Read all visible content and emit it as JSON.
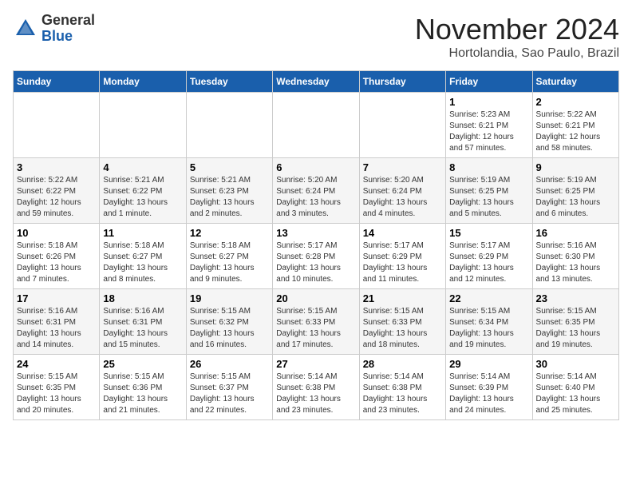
{
  "header": {
    "logo_general": "General",
    "logo_blue": "Blue",
    "month_title": "November 2024",
    "location": "Hortolandia, Sao Paulo, Brazil"
  },
  "weekdays": [
    "Sunday",
    "Monday",
    "Tuesday",
    "Wednesday",
    "Thursday",
    "Friday",
    "Saturday"
  ],
  "weeks": [
    [
      {
        "day": "",
        "info": ""
      },
      {
        "day": "",
        "info": ""
      },
      {
        "day": "",
        "info": ""
      },
      {
        "day": "",
        "info": ""
      },
      {
        "day": "",
        "info": ""
      },
      {
        "day": "1",
        "info": "Sunrise: 5:23 AM\nSunset: 6:21 PM\nDaylight: 12 hours and 57 minutes."
      },
      {
        "day": "2",
        "info": "Sunrise: 5:22 AM\nSunset: 6:21 PM\nDaylight: 12 hours and 58 minutes."
      }
    ],
    [
      {
        "day": "3",
        "info": "Sunrise: 5:22 AM\nSunset: 6:22 PM\nDaylight: 12 hours and 59 minutes."
      },
      {
        "day": "4",
        "info": "Sunrise: 5:21 AM\nSunset: 6:22 PM\nDaylight: 13 hours and 1 minute."
      },
      {
        "day": "5",
        "info": "Sunrise: 5:21 AM\nSunset: 6:23 PM\nDaylight: 13 hours and 2 minutes."
      },
      {
        "day": "6",
        "info": "Sunrise: 5:20 AM\nSunset: 6:24 PM\nDaylight: 13 hours and 3 minutes."
      },
      {
        "day": "7",
        "info": "Sunrise: 5:20 AM\nSunset: 6:24 PM\nDaylight: 13 hours and 4 minutes."
      },
      {
        "day": "8",
        "info": "Sunrise: 5:19 AM\nSunset: 6:25 PM\nDaylight: 13 hours and 5 minutes."
      },
      {
        "day": "9",
        "info": "Sunrise: 5:19 AM\nSunset: 6:25 PM\nDaylight: 13 hours and 6 minutes."
      }
    ],
    [
      {
        "day": "10",
        "info": "Sunrise: 5:18 AM\nSunset: 6:26 PM\nDaylight: 13 hours and 7 minutes."
      },
      {
        "day": "11",
        "info": "Sunrise: 5:18 AM\nSunset: 6:27 PM\nDaylight: 13 hours and 8 minutes."
      },
      {
        "day": "12",
        "info": "Sunrise: 5:18 AM\nSunset: 6:27 PM\nDaylight: 13 hours and 9 minutes."
      },
      {
        "day": "13",
        "info": "Sunrise: 5:17 AM\nSunset: 6:28 PM\nDaylight: 13 hours and 10 minutes."
      },
      {
        "day": "14",
        "info": "Sunrise: 5:17 AM\nSunset: 6:29 PM\nDaylight: 13 hours and 11 minutes."
      },
      {
        "day": "15",
        "info": "Sunrise: 5:17 AM\nSunset: 6:29 PM\nDaylight: 13 hours and 12 minutes."
      },
      {
        "day": "16",
        "info": "Sunrise: 5:16 AM\nSunset: 6:30 PM\nDaylight: 13 hours and 13 minutes."
      }
    ],
    [
      {
        "day": "17",
        "info": "Sunrise: 5:16 AM\nSunset: 6:31 PM\nDaylight: 13 hours and 14 minutes."
      },
      {
        "day": "18",
        "info": "Sunrise: 5:16 AM\nSunset: 6:31 PM\nDaylight: 13 hours and 15 minutes."
      },
      {
        "day": "19",
        "info": "Sunrise: 5:15 AM\nSunset: 6:32 PM\nDaylight: 13 hours and 16 minutes."
      },
      {
        "day": "20",
        "info": "Sunrise: 5:15 AM\nSunset: 6:33 PM\nDaylight: 13 hours and 17 minutes."
      },
      {
        "day": "21",
        "info": "Sunrise: 5:15 AM\nSunset: 6:33 PM\nDaylight: 13 hours and 18 minutes."
      },
      {
        "day": "22",
        "info": "Sunrise: 5:15 AM\nSunset: 6:34 PM\nDaylight: 13 hours and 19 minutes."
      },
      {
        "day": "23",
        "info": "Sunrise: 5:15 AM\nSunset: 6:35 PM\nDaylight: 13 hours and 19 minutes."
      }
    ],
    [
      {
        "day": "24",
        "info": "Sunrise: 5:15 AM\nSunset: 6:35 PM\nDaylight: 13 hours and 20 minutes."
      },
      {
        "day": "25",
        "info": "Sunrise: 5:15 AM\nSunset: 6:36 PM\nDaylight: 13 hours and 21 minutes."
      },
      {
        "day": "26",
        "info": "Sunrise: 5:15 AM\nSunset: 6:37 PM\nDaylight: 13 hours and 22 minutes."
      },
      {
        "day": "27",
        "info": "Sunrise: 5:14 AM\nSunset: 6:38 PM\nDaylight: 13 hours and 23 minutes."
      },
      {
        "day": "28",
        "info": "Sunrise: 5:14 AM\nSunset: 6:38 PM\nDaylight: 13 hours and 23 minutes."
      },
      {
        "day": "29",
        "info": "Sunrise: 5:14 AM\nSunset: 6:39 PM\nDaylight: 13 hours and 24 minutes."
      },
      {
        "day": "30",
        "info": "Sunrise: 5:14 AM\nSunset: 6:40 PM\nDaylight: 13 hours and 25 minutes."
      }
    ]
  ]
}
